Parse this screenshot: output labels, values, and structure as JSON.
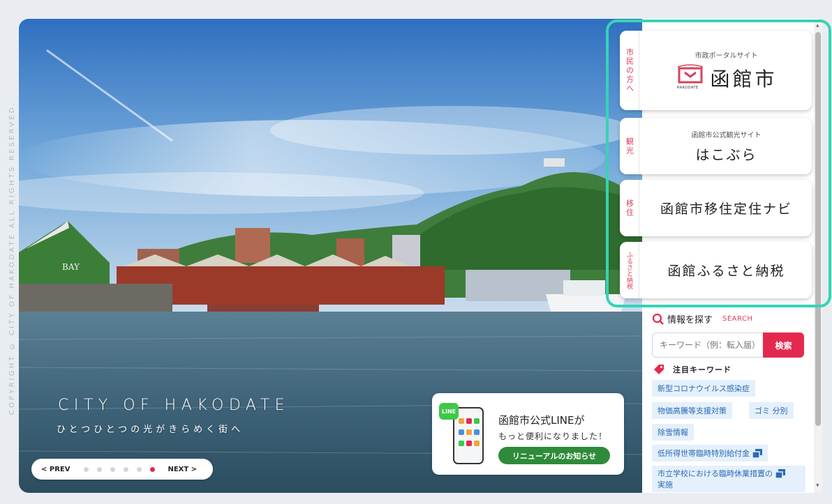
{
  "copyright": "COPYRIGHT © CITY OF HAKODATE ALL RIGHTS RESERVED.",
  "hero": {
    "title": "CITY OF HAKODATE",
    "subtitle": "ひとつひとつの光がきらめく街へ",
    "building_sign": "BAY"
  },
  "slider": {
    "prev_label": "< PREV",
    "next_label": "NEXT >",
    "dot_count": 6,
    "active_index": 6
  },
  "line_banner": {
    "badge": "LINE",
    "line1": "函館市公式LINEが",
    "line2": "もっと便利になりました！",
    "button": "リニューアルのお知らせ"
  },
  "portals": [
    {
      "tag": "市民の方へ",
      "small": "市政ポータルサイト",
      "big": "函館市",
      "logo_sub": "HAKODATE"
    },
    {
      "tag": "観光",
      "small": "函館市公式観光サイト",
      "big": "はこぶら"
    },
    {
      "tag": "移住",
      "small": "",
      "big": "函館市移住定住ナビ"
    },
    {
      "tag": "ふるさと納税",
      "small": "",
      "big": "函館ふるさと納税"
    }
  ],
  "search": {
    "title": "情報を探す",
    "title_en": "SEARCH",
    "placeholder": "キーワード（例：転入届）",
    "button": "検索"
  },
  "keywords": {
    "label": "注目キーワード",
    "items": [
      "新型コロナウイルス感染症",
      "物価高騰等支援対策",
      "ゴミ 分別",
      "除雪情報",
      "低所得世帯臨時特別給付金",
      "市立学校における臨時休業措置の",
      "実施"
    ]
  },
  "colors": {
    "accent_red": "#e4294f",
    "highlight_teal": "#37d3b5",
    "line_green": "#3ec84a",
    "chip_bg": "#e4f0fb",
    "chip_text": "#2b6ab3"
  }
}
